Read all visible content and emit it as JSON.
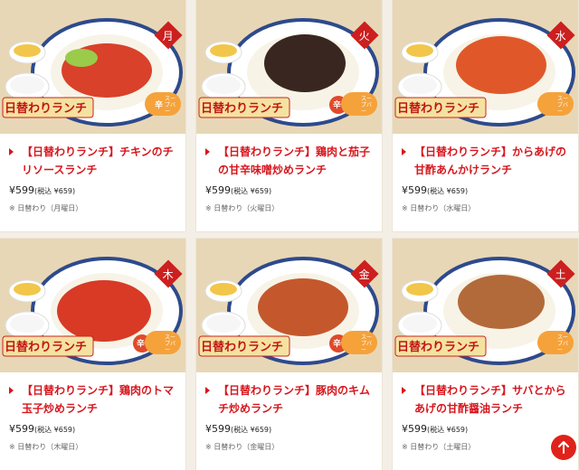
{
  "menu": [
    {
      "title": "【日替わりランチ】チキンのチリソースランチ",
      "price": "¥599",
      "tax_price": "(税込 ¥659)",
      "note": "※ 日替わり（月曜日）",
      "day_badge": "月",
      "banner": "日替わりランチ",
      "spicy_label": "辛",
      "soup_label": "スープバー"
    },
    {
      "title": "【日替わりランチ】鶏肉と茄子の甘辛味噌炒めランチ",
      "price": "¥599",
      "tax_price": "(税込 ¥659)",
      "note": "※ 日替わり（火曜日）",
      "day_badge": "火",
      "banner": "日替わりランチ",
      "spicy_label": "辛",
      "soup_label": "スープバー"
    },
    {
      "title": "【日替わりランチ】からあげの甘酢あんかけランチ",
      "price": "¥599",
      "tax_price": "(税込 ¥659)",
      "note": "※ 日替わり（水曜日）",
      "day_badge": "水",
      "banner": "日替わりランチ",
      "spicy_label": "",
      "soup_label": "スープバー"
    },
    {
      "title": "【日替わりランチ】鶏肉のトマ玉子炒めランチ",
      "price": "¥599",
      "tax_price": "(税込 ¥659)",
      "note": "※ 日替わり（木曜日）",
      "day_badge": "木",
      "banner": "日替わりランチ",
      "spicy_label": "辛",
      "soup_label": "スープバー"
    },
    {
      "title": "【日替わりランチ】豚肉のキムチ炒めランチ",
      "price": "¥599",
      "tax_price": "(税込 ¥659)",
      "note": "※ 日替わり（金曜日）",
      "day_badge": "金",
      "banner": "日替わりランチ",
      "spicy_label": "辛",
      "soup_label": "スープバー"
    },
    {
      "title": "【日替わりランチ】サバとからあげの甘酢醤油ランチ",
      "price": "¥599",
      "tax_price": "(税込 ¥659)",
      "note": "※ 日替わり（土曜日）",
      "day_badge": "土",
      "banner": "日替わりランチ",
      "spicy_label": "",
      "soup_label": "スープバー"
    }
  ],
  "colors": {
    "accent": "#d7161d",
    "banner_bg": "#f4e2a0",
    "badge_bg": "#cc1f1f",
    "food": [
      "#d9412a",
      "#3a2620",
      "#e0582a",
      "#d83a26",
      "#c4582c",
      "#b36a3a"
    ]
  },
  "back_to_top_icon": "arrow-up-icon"
}
